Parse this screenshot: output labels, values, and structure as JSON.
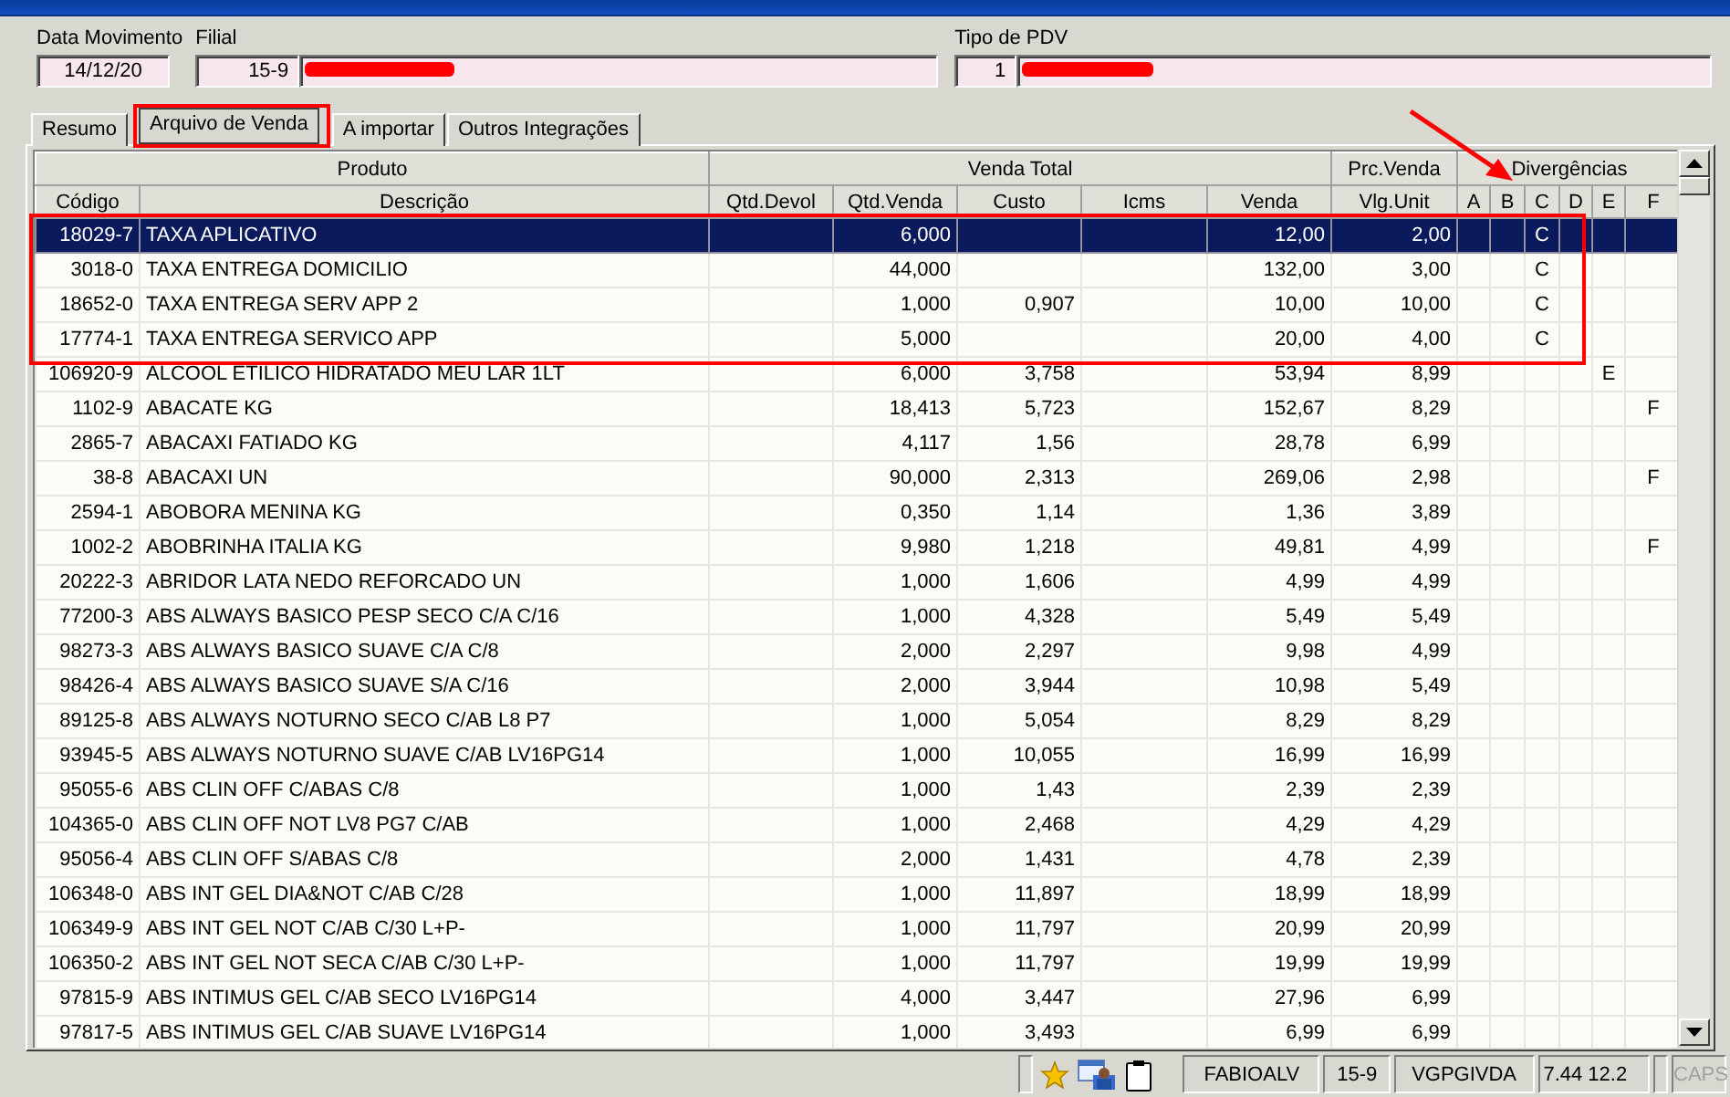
{
  "header": {
    "data_movimento": {
      "label": "Data Movimento",
      "value": "14/12/20"
    },
    "filial": {
      "label": "Filial",
      "code": "15-9"
    },
    "tipo_pdv": {
      "label": "Tipo de PDV",
      "code": "1"
    }
  },
  "tabs": [
    {
      "label": "Resumo",
      "selected": false,
      "highlighted": false
    },
    {
      "label": "Arquivo de Venda",
      "selected": true,
      "highlighted": true
    },
    {
      "label": "A importar",
      "selected": false,
      "highlighted": false
    },
    {
      "label": "Outros Integrações",
      "selected": false,
      "highlighted": false
    }
  ],
  "table": {
    "column_groups": [
      {
        "label": "Produto",
        "columns": [
          "Código",
          "Descrição"
        ]
      },
      {
        "label": "Venda Total",
        "columns": [
          "Qtd.Devol",
          "Qtd.Venda",
          "Custo",
          "Icms",
          "Venda"
        ]
      },
      {
        "label": "Prc.Venda",
        "columns": [
          "Vlg.Unit"
        ]
      },
      {
        "label": "Divergências",
        "columns": [
          "A",
          "B",
          "C",
          "D",
          "E",
          "F"
        ]
      }
    ],
    "rows": [
      {
        "selected": true,
        "cells": [
          "18029-7",
          "TAXA APLICATIVO",
          null,
          "6,000",
          null,
          null,
          "12,00",
          "2,00",
          null,
          null,
          "C",
          null,
          null,
          null
        ]
      },
      {
        "selected": false,
        "cells": [
          "3018-0",
          "TAXA ENTREGA DOMICILIO",
          null,
          "44,000",
          null,
          null,
          "132,00",
          "3,00",
          null,
          null,
          "C",
          null,
          null,
          null
        ]
      },
      {
        "selected": false,
        "cells": [
          "18652-0",
          "TAXA ENTREGA SERV APP 2",
          null,
          "1,000",
          "0,907",
          null,
          "10,00",
          "10,00",
          null,
          null,
          "C",
          null,
          null,
          null
        ]
      },
      {
        "selected": false,
        "cells": [
          "17774-1",
          "TAXA ENTREGA SERVICO APP",
          null,
          "5,000",
          null,
          null,
          "20,00",
          "4,00",
          null,
          null,
          "C",
          null,
          null,
          null
        ]
      },
      {
        "selected": false,
        "cells": [
          "106920-9",
          "ALCOOL ETILICO HIDRATADO MEU LAR 1LT",
          null,
          "6,000",
          "3,758",
          null,
          "53,94",
          "8,99",
          null,
          null,
          null,
          null,
          "E",
          null
        ]
      },
      {
        "selected": false,
        "cells": [
          "1102-9",
          "ABACATE KG",
          null,
          "18,413",
          "5,723",
          null,
          "152,67",
          "8,29",
          null,
          null,
          null,
          null,
          null,
          "F"
        ]
      },
      {
        "selected": false,
        "cells": [
          "2865-7",
          "ABACAXI FATIADO KG",
          null,
          "4,117",
          "1,56",
          null,
          "28,78",
          "6,99",
          null,
          null,
          null,
          null,
          null,
          null
        ]
      },
      {
        "selected": false,
        "cells": [
          "38-8",
          "ABACAXI UN",
          null,
          "90,000",
          "2,313",
          null,
          "269,06",
          "2,98",
          null,
          null,
          null,
          null,
          null,
          "F"
        ]
      },
      {
        "selected": false,
        "cells": [
          "2594-1",
          "ABOBORA MENINA KG",
          null,
          "0,350",
          "1,14",
          null,
          "1,36",
          "3,89",
          null,
          null,
          null,
          null,
          null,
          null
        ]
      },
      {
        "selected": false,
        "cells": [
          "1002-2",
          "ABOBRINHA ITALIA KG",
          null,
          "9,980",
          "1,218",
          null,
          "49,81",
          "4,99",
          null,
          null,
          null,
          null,
          null,
          "F"
        ]
      },
      {
        "selected": false,
        "cells": [
          "20222-3",
          "ABRIDOR LATA NEDO REFORCADO UN",
          null,
          "1,000",
          "1,606",
          null,
          "4,99",
          "4,99",
          null,
          null,
          null,
          null,
          null,
          null
        ]
      },
      {
        "selected": false,
        "cells": [
          "77200-3",
          "ABS ALWAYS BASICO PESP SECO C/A C/16",
          null,
          "1,000",
          "4,328",
          null,
          "5,49",
          "5,49",
          null,
          null,
          null,
          null,
          null,
          null
        ]
      },
      {
        "selected": false,
        "cells": [
          "98273-3",
          "ABS ALWAYS BASICO SUAVE C/A C/8",
          null,
          "2,000",
          "2,297",
          null,
          "9,98",
          "4,99",
          null,
          null,
          null,
          null,
          null,
          null
        ]
      },
      {
        "selected": false,
        "cells": [
          "98426-4",
          "ABS ALWAYS BASICO SUAVE S/A C/16",
          null,
          "2,000",
          "3,944",
          null,
          "10,98",
          "5,49",
          null,
          null,
          null,
          null,
          null,
          null
        ]
      },
      {
        "selected": false,
        "cells": [
          "89125-8",
          "ABS ALWAYS NOTURNO SECO C/AB L8 P7",
          null,
          "1,000",
          "5,054",
          null,
          "8,29",
          "8,29",
          null,
          null,
          null,
          null,
          null,
          null
        ]
      },
      {
        "selected": false,
        "cells": [
          "93945-5",
          "ABS ALWAYS NOTURNO SUAVE C/AB LV16PG14",
          null,
          "1,000",
          "10,055",
          null,
          "16,99",
          "16,99",
          null,
          null,
          null,
          null,
          null,
          null
        ]
      },
      {
        "selected": false,
        "cells": [
          "95055-6",
          "ABS CLIN OFF C/ABAS C/8",
          null,
          "1,000",
          "1,43",
          null,
          "2,39",
          "2,39",
          null,
          null,
          null,
          null,
          null,
          null
        ]
      },
      {
        "selected": false,
        "cells": [
          "104365-0",
          "ABS CLIN OFF NOT LV8 PG7 C/AB",
          null,
          "1,000",
          "2,468",
          null,
          "4,29",
          "4,29",
          null,
          null,
          null,
          null,
          null,
          null
        ]
      },
      {
        "selected": false,
        "cells": [
          "95056-4",
          "ABS CLIN OFF S/ABAS C/8",
          null,
          "2,000",
          "1,431",
          null,
          "4,78",
          "2,39",
          null,
          null,
          null,
          null,
          null,
          null
        ]
      },
      {
        "selected": false,
        "cells": [
          "106348-0",
          "ABS INT GEL DIA&NOT C/AB C/28",
          null,
          "1,000",
          "11,897",
          null,
          "18,99",
          "18,99",
          null,
          null,
          null,
          null,
          null,
          null
        ]
      },
      {
        "selected": false,
        "cells": [
          "106349-9",
          "ABS INT GEL NOT C/AB C/30 L+P-",
          null,
          "1,000",
          "11,797",
          null,
          "20,99",
          "20,99",
          null,
          null,
          null,
          null,
          null,
          null
        ]
      },
      {
        "selected": false,
        "cells": [
          "106350-2",
          "ABS INT GEL NOT SECA C/AB C/30 L+P-",
          null,
          "1,000",
          "11,797",
          null,
          "19,99",
          "19,99",
          null,
          null,
          null,
          null,
          null,
          null
        ]
      },
      {
        "selected": false,
        "cells": [
          "97815-9",
          "ABS INTIMUS GEL C/AB SECO LV16PG14",
          null,
          "4,000",
          "3,447",
          null,
          "27,96",
          "6,99",
          null,
          null,
          null,
          null,
          null,
          null
        ]
      },
      {
        "selected": false,
        "cells": [
          "97817-5",
          "ABS INTIMUS GEL C/AB SUAVE LV16PG14",
          null,
          "1,000",
          "3,493",
          null,
          "6,99",
          "6,99",
          null,
          null,
          null,
          null,
          null,
          null
        ]
      }
    ]
  },
  "status_bar": {
    "user": "FABIOALV",
    "filial": "15-9",
    "program": "VGPGIVDA",
    "version": "7.44 12.2",
    "caps": {
      "label": "CAPS",
      "disabled": true
    }
  }
}
